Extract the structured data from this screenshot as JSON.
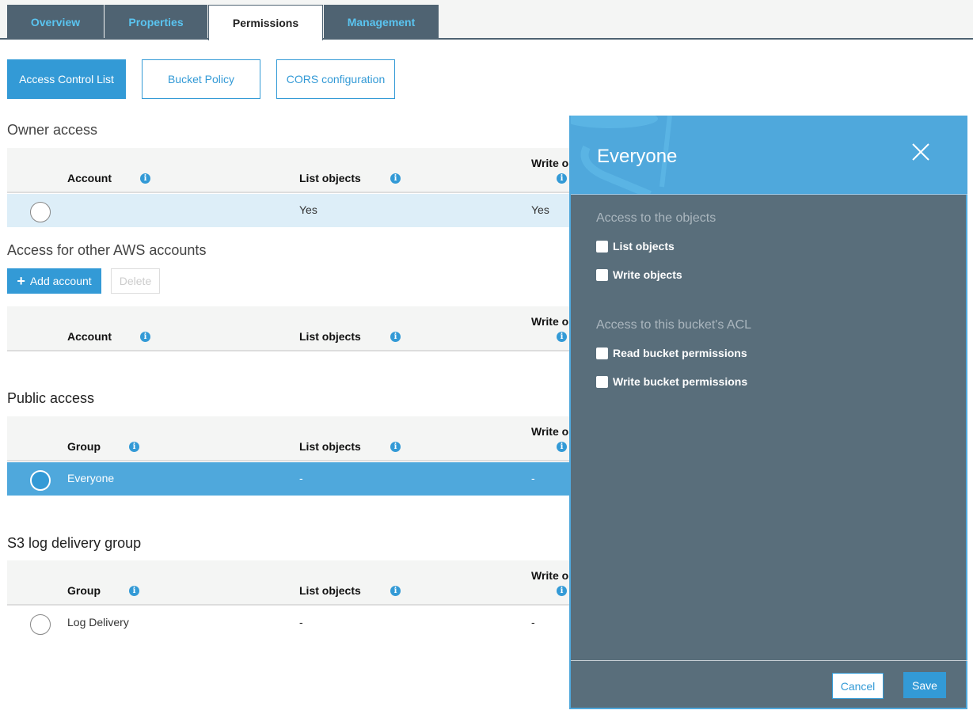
{
  "tabs": [
    {
      "label": "Overview",
      "active": false
    },
    {
      "label": "Properties",
      "active": false
    },
    {
      "label": "Permissions",
      "active": true
    },
    {
      "label": "Management",
      "active": false
    }
  ],
  "subtabs": [
    {
      "label": "Access Control List",
      "active": true
    },
    {
      "label": "Bucket Policy",
      "active": false
    },
    {
      "label": "CORS configuration",
      "active": false
    }
  ],
  "owner": {
    "title": "Owner access",
    "headers": [
      "Account",
      "List objects",
      "Write o"
    ],
    "rows": [
      {
        "name": "",
        "list": "Yes",
        "write": "Yes"
      }
    ]
  },
  "other": {
    "title": "Access for other AWS accounts",
    "add_label": "Add account",
    "delete_label": "Delete",
    "headers": [
      "Account",
      "List objects",
      "Write o"
    ]
  },
  "public": {
    "title": "Public access",
    "headers": [
      "Group",
      "List objects",
      "Write o"
    ],
    "rows": [
      {
        "name": "Everyone",
        "list": "-",
        "write": "-"
      }
    ]
  },
  "logdelivery": {
    "title": "S3 log delivery group",
    "headers": [
      "Group",
      "List objects",
      "Write o"
    ],
    "rows": [
      {
        "name": "Log Delivery",
        "list": "-",
        "write": "-"
      }
    ]
  },
  "panel": {
    "title": "Everyone",
    "objects_label": "Access to the objects",
    "objects": [
      {
        "label": "List objects",
        "checked": false
      },
      {
        "label": "Write objects",
        "checked": false
      }
    ],
    "acl_label": "Access to this bucket's ACL",
    "acl": [
      {
        "label": "Read bucket permissions",
        "checked": false
      },
      {
        "label": "Write bucket permissions",
        "checked": false
      }
    ],
    "cancel_label": "Cancel",
    "save_label": "Save"
  },
  "colors": {
    "accent": "#339ad6",
    "tab_bg": "#4f6372",
    "panel_bg": "#596e7b",
    "selected_row": "#4fa8dc",
    "owner_row": "#ddeef8"
  }
}
